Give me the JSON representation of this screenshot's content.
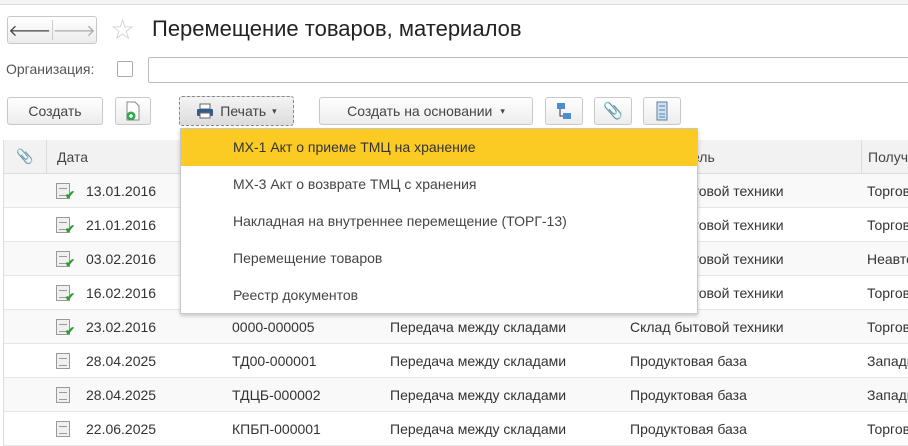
{
  "window": {
    "title": "Перемещение товаров, материалов",
    "back": "🡐",
    "forward": "🡒",
    "favorite": "☆"
  },
  "filter": {
    "org_label": "Организация:",
    "org_value": ""
  },
  "toolbar": {
    "create": "Создать",
    "print": "Печать",
    "print_arrow": "▾",
    "create_based": "Создать на основании",
    "create_based_arrow": "▾"
  },
  "table": {
    "headers": [
      "Дата",
      "",
      "",
      "Отправитель",
      "Получатель"
    ],
    "rows": [
      {
        "posted": true,
        "date": "13.01.2016",
        "number": "",
        "operation": "",
        "sender": "Склад бытовой техники",
        "receiver": "Торговый зал"
      },
      {
        "posted": true,
        "date": "21.01.2016",
        "number": "",
        "operation": "",
        "sender": "Склад бытовой техники",
        "receiver": "Торговый зал"
      },
      {
        "posted": true,
        "date": "03.02.2016",
        "number": "",
        "operation": "",
        "sender": "Склад бытовой техники",
        "receiver": "Неавтоматизированная"
      },
      {
        "posted": true,
        "date": "16.02.2016",
        "number": "",
        "operation": "",
        "sender": "Склад бытовой техники",
        "receiver": "Торговый зал"
      },
      {
        "posted": true,
        "date": "23.02.2016",
        "number": "0000-000005",
        "operation": "Передача между складами",
        "sender": "Склад бытовой техники",
        "receiver": "Торговый зал"
      },
      {
        "posted": false,
        "date": "28.04.2025",
        "number": "ТД00-000001",
        "operation": "Передача между складами",
        "sender": "Продуктовая база",
        "receiver": "Западный"
      },
      {
        "posted": false,
        "date": "28.04.2025",
        "number": "ТДЦБ-000002",
        "operation": "Передача между складами",
        "sender": "Продуктовая база",
        "receiver": "Западный"
      },
      {
        "posted": false,
        "date": "22.06.2025",
        "number": "КПБП-000001",
        "operation": "Передача между складами",
        "sender": "Продуктовая база",
        "receiver": "Торговый"
      }
    ]
  },
  "print_menu": {
    "items": [
      "МХ-1 Акт о приеме ТМЦ на хранение",
      "МХ-3 Акт о возврате ТМЦ с хранения",
      "Накладная на внутреннее перемещение (ТОРГ-13)",
      "Перемещение товаров",
      "Реестр документов"
    ],
    "highlight_color": "#fbcb24"
  }
}
